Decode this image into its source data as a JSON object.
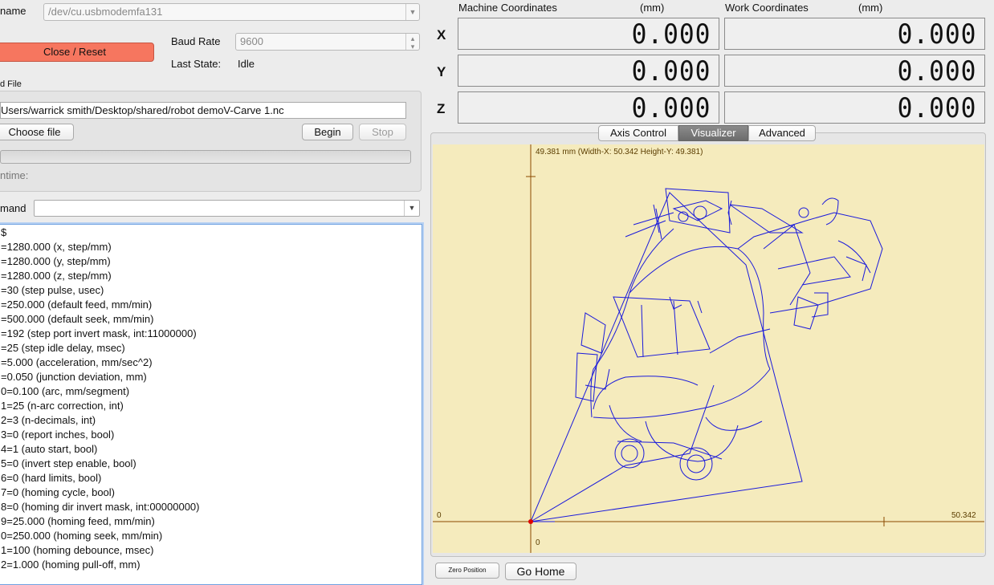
{
  "port": {
    "label": "name",
    "value": "/dev/cu.usbmodemfa131"
  },
  "connect_button": "Close / Reset",
  "baud": {
    "label": "Baud Rate",
    "value": "9600"
  },
  "state": {
    "label": "Last State:",
    "value": "Idle"
  },
  "file_panel": {
    "title": "d File",
    "path": "Users/warrick smith/Desktop/shared/robot demoV-Carve 1.nc",
    "choose_label": "Choose file",
    "begin_label": "Begin",
    "stop_label": "Stop",
    "runtime_label": "ntime:"
  },
  "command": {
    "label": "mand",
    "value": ""
  },
  "console_lines": [
    "$",
    "=1280.000 (x, step/mm)",
    "=1280.000 (y, step/mm)",
    "=1280.000 (z, step/mm)",
    "=30 (step pulse, usec)",
    "=250.000 (default feed, mm/min)",
    "=500.000 (default seek, mm/min)",
    "=192 (step port invert mask, int:11000000)",
    "=25 (step idle delay, msec)",
    "=5.000 (acceleration, mm/sec^2)",
    "=0.050 (junction deviation, mm)",
    "0=0.100 (arc, mm/segment)",
    "1=25 (n-arc correction, int)",
    "2=3 (n-decimals, int)",
    "3=0 (report inches, bool)",
    "4=1 (auto start, bool)",
    "5=0 (invert step enable, bool)",
    "6=0 (hard limits, bool)",
    "7=0 (homing cycle, bool)",
    "8=0 (homing dir invert mask, int:00000000)",
    "9=25.000 (homing feed, mm/min)",
    "0=250.000 (homing seek, mm/min)",
    "1=100 (homing debounce, msec)",
    "2=1.000 (homing pull-off, mm)"
  ],
  "machine": {
    "title": "Machine Coordinates",
    "unit": "(mm)",
    "x": "0.000",
    "y": "0.000",
    "z": "0.000"
  },
  "work": {
    "title": "Work Coordinates",
    "unit": "(mm)",
    "x": "0.000",
    "y": "0.000",
    "z": "0.000"
  },
  "axes": [
    "X",
    "Y",
    "Z"
  ],
  "tabs": [
    "Axis Control",
    "Visualizer",
    "Advanced"
  ],
  "active_tab": "Visualizer",
  "visualizer": {
    "header": "49.381 mm  (Width-X: 50.342  Height-Y: 49.381)",
    "x_min": "0",
    "x_max": "50.342",
    "y_min": "0",
    "background": "#f5ebbd",
    "axis_color": "#8a4a00",
    "path_color": "#1a1adb",
    "origin_color": "#e00000"
  },
  "zero_position_label": "Zero Position",
  "go_home_label": "Go Home"
}
